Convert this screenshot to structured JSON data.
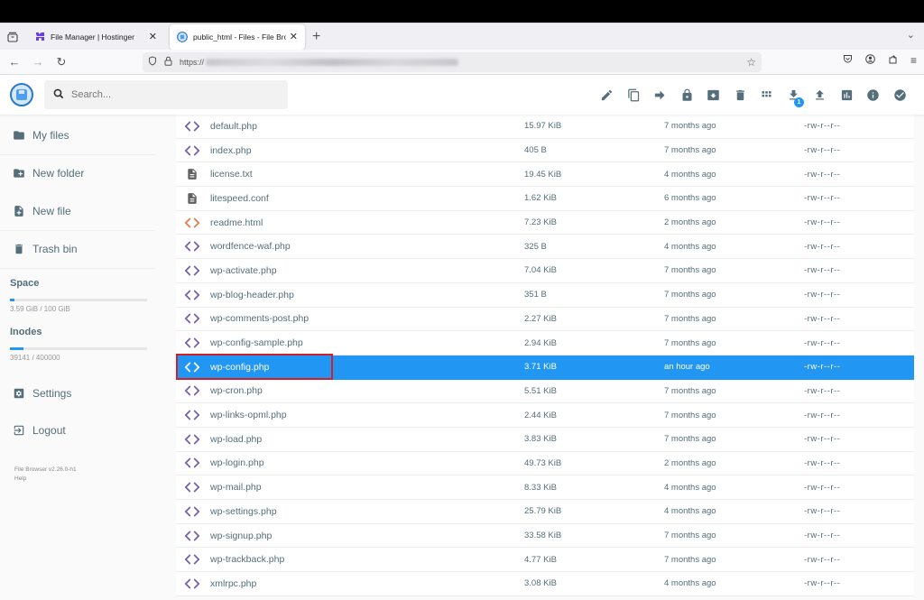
{
  "browser": {
    "tabs": [
      {
        "title": "File Manager | Hostinger",
        "active": false,
        "favicon": "hostinger-logo-icon"
      },
      {
        "title": "public_html - Files - File Browser",
        "active": true,
        "favicon": "filebrowser-logo-icon"
      }
    ],
    "url_prefix": "https://",
    "url_obscured": true
  },
  "app": {
    "search_placeholder": "Search...",
    "actions": [
      {
        "name": "rename",
        "icon": "pencil-icon"
      },
      {
        "name": "copy",
        "icon": "copy-icon"
      },
      {
        "name": "move",
        "icon": "arrow-right-icon"
      },
      {
        "name": "permissions",
        "icon": "lock-icon"
      },
      {
        "name": "archive",
        "icon": "archive-icon"
      },
      {
        "name": "delete",
        "icon": "trash-icon"
      },
      {
        "name": "view-mode",
        "icon": "grid-icon"
      },
      {
        "name": "download",
        "icon": "download-icon",
        "badge": "1"
      },
      {
        "name": "upload",
        "icon": "upload-icon"
      },
      {
        "name": "disk-usage",
        "icon": "chart-icon"
      },
      {
        "name": "info",
        "icon": "info-icon"
      },
      {
        "name": "select",
        "icon": "check-circle-icon"
      }
    ]
  },
  "sidebar": {
    "items": [
      {
        "label": "My files",
        "icon": "folder-icon"
      },
      {
        "label": "New folder",
        "icon": "folder-plus-icon"
      },
      {
        "label": "New file",
        "icon": "file-plus-icon"
      },
      {
        "label": "Trash bin",
        "icon": "trash-icon"
      }
    ],
    "space": {
      "label": "Space",
      "text": "3.59 GiB / 100 GiB",
      "used_fraction": 0.0359
    },
    "inodes": {
      "label": "Inodes",
      "text": "39141 / 400000",
      "used_fraction": 0.0979
    },
    "bottom_items": [
      {
        "label": "Settings",
        "icon": "settings-icon"
      },
      {
        "label": "Logout",
        "icon": "logout-icon"
      }
    ],
    "version": "File Browser v2.26.0-h1",
    "help": "Help"
  },
  "files": [
    {
      "name": "default.php",
      "size": "15.97 KiB",
      "modified": "7 months ago",
      "perm": "-rw-r--r--",
      "type": "code"
    },
    {
      "name": "index.php",
      "size": "405 B",
      "modified": "7 months ago",
      "perm": "-rw-r--r--",
      "type": "code"
    },
    {
      "name": "license.txt",
      "size": "19.45 KiB",
      "modified": "4 months ago",
      "perm": "-rw-r--r--",
      "type": "text"
    },
    {
      "name": "litespeed.conf",
      "size": "1.62 KiB",
      "modified": "6 months ago",
      "perm": "-rw-r--r--",
      "type": "text"
    },
    {
      "name": "readme.html",
      "size": "7.23 KiB",
      "modified": "2 months ago",
      "perm": "-rw-r--r--",
      "type": "html"
    },
    {
      "name": "wordfence-waf.php",
      "size": "325 B",
      "modified": "4 months ago",
      "perm": "-rw-r--r--",
      "type": "code"
    },
    {
      "name": "wp-activate.php",
      "size": "7.04 KiB",
      "modified": "7 months ago",
      "perm": "-rw-r--r--",
      "type": "code"
    },
    {
      "name": "wp-blog-header.php",
      "size": "351 B",
      "modified": "7 months ago",
      "perm": "-rw-r--r--",
      "type": "code"
    },
    {
      "name": "wp-comments-post.php",
      "size": "2.27 KiB",
      "modified": "7 months ago",
      "perm": "-rw-r--r--",
      "type": "code"
    },
    {
      "name": "wp-config-sample.php",
      "size": "2.94 KiB",
      "modified": "7 months ago",
      "perm": "-rw-r--r--",
      "type": "code"
    },
    {
      "name": "wp-config.php",
      "size": "3.71 KiB",
      "modified": "an hour ago",
      "perm": "-rw-r--r--",
      "type": "code",
      "selected": true,
      "highlighted": true
    },
    {
      "name": "wp-cron.php",
      "size": "5.51 KiB",
      "modified": "7 months ago",
      "perm": "-rw-r--r--",
      "type": "code"
    },
    {
      "name": "wp-links-opml.php",
      "size": "2.44 KiB",
      "modified": "7 months ago",
      "perm": "-rw-r--r--",
      "type": "code"
    },
    {
      "name": "wp-load.php",
      "size": "3.83 KiB",
      "modified": "7 months ago",
      "perm": "-rw-r--r--",
      "type": "code"
    },
    {
      "name": "wp-login.php",
      "size": "49.73 KiB",
      "modified": "2 months ago",
      "perm": "-rw-r--r--",
      "type": "code"
    },
    {
      "name": "wp-mail.php",
      "size": "8.33 KiB",
      "modified": "4 months ago",
      "perm": "-rw-r--r--",
      "type": "code"
    },
    {
      "name": "wp-settings.php",
      "size": "25.79 KiB",
      "modified": "4 months ago",
      "perm": "-rw-r--r--",
      "type": "code"
    },
    {
      "name": "wp-signup.php",
      "size": "33.58 KiB",
      "modified": "7 months ago",
      "perm": "-rw-r--r--",
      "type": "code"
    },
    {
      "name": "wp-trackback.php",
      "size": "4.77 KiB",
      "modified": "7 months ago",
      "perm": "-rw-r--r--",
      "type": "code"
    },
    {
      "name": "xmlrpc.php",
      "size": "3.08 KiB",
      "modified": "4 months ago",
      "perm": "-rw-r--r--",
      "type": "code"
    }
  ],
  "colors": {
    "accent": "#2196f3",
    "code_icon": "#7b5ea7",
    "html_icon": "#e07b4f",
    "text_icon": "#616161",
    "highlight_border": "#d0202a"
  }
}
